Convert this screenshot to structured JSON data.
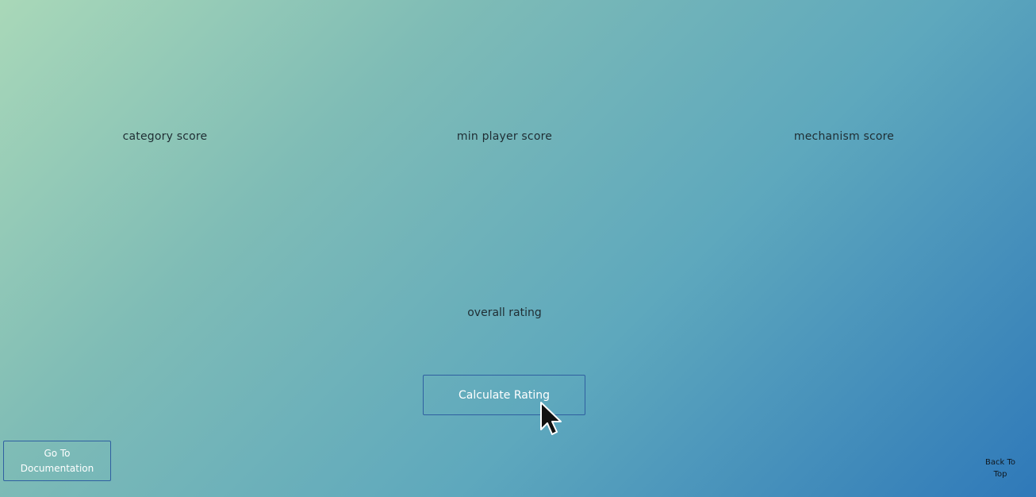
{
  "scores": {
    "category_label": "category score",
    "min_player_label": "min player score",
    "mechanism_label": "mechanism score"
  },
  "overall": {
    "label": "overall rating"
  },
  "actions": {
    "calculate_label": "Calculate Rating",
    "docs_label_line1": "Go To",
    "docs_label_line2": "Documentation",
    "back_to_top_line1": "Back To",
    "back_to_top_line2": "Top"
  },
  "icons": {
    "cursor": "mouse-pointer-icon"
  },
  "colors": {
    "gradient_start": "#a9d8b8",
    "gradient_end": "#2f79b9",
    "button_border": "#2f5fa0",
    "button_text": "#ffffff"
  }
}
